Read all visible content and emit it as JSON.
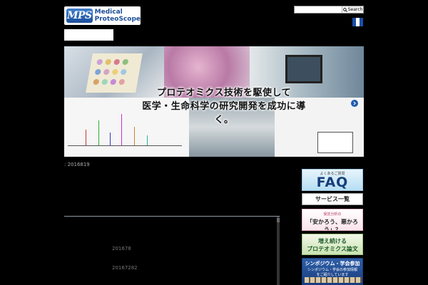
{
  "header": {
    "logo": {
      "mark": "MPS",
      "line1": "Medical",
      "line2": "ProteoScope"
    },
    "search": {
      "placeholder": "",
      "button_label": "Search"
    },
    "language_flag": "finland-flag-icon"
  },
  "hero": {
    "caption_line1": "プロテオミクス技術を駆使して",
    "caption_line2": "医学・生命科学の研究開発を成功に導く。",
    "next_icon": "chevron-right-icon"
  },
  "post": {
    "date": ": 2016819"
  },
  "content_list": {
    "items": [
      {
        "date": "201678"
      },
      {
        "date": "20167282"
      }
    ]
  },
  "sidebar": {
    "faq": {
      "small": "よくあるご質問",
      "big": "FAQ"
    },
    "services": {
      "label": "サービス一覧"
    },
    "proteomics_banner": {
      "small": "受託分析の",
      "main": "「安かろう、悪かろう」？"
    },
    "papers_banner": {
      "line1": "増え続ける",
      "line2": "プロテオミクス論文"
    },
    "symposium_banner": {
      "title": "シンポジウム・学会参加",
      "line1": "シンポジウム・学会の参加情報",
      "line2": "をご紹介しています"
    }
  },
  "colors": {
    "background": "#000000",
    "accent_blue": "#1f5bb2",
    "faq_text": "#173d7a"
  }
}
